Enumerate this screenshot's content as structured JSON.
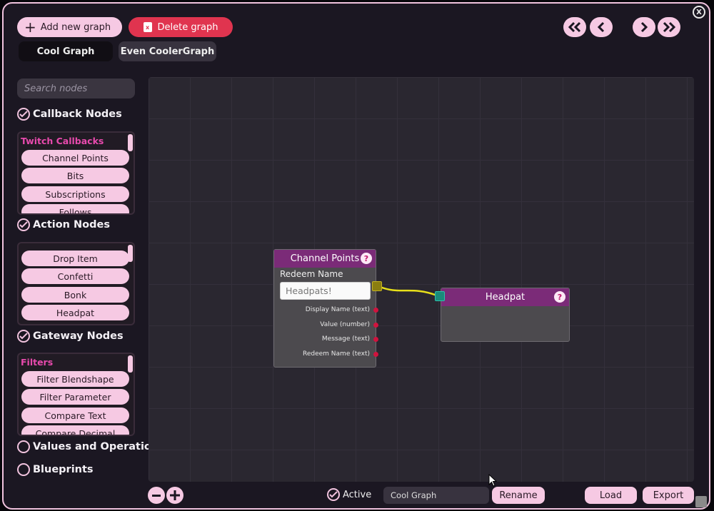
{
  "toolbar": {
    "add_graph_label": "Add new graph",
    "delete_graph_label": "Delete graph",
    "close_label": "X"
  },
  "tabs": [
    {
      "label": "Cool Graph",
      "active": true
    },
    {
      "label": "Even CoolerGraph",
      "active": false
    }
  ],
  "nav": {
    "first_icon": "double-chevron-left-icon",
    "prev_icon": "chevron-left-icon",
    "next_icon": "chevron-right-icon",
    "last_icon": "double-chevron-right-icon"
  },
  "sidebar": {
    "search_placeholder": "Search nodes",
    "sections": [
      {
        "label": "Callback Nodes",
        "checked": true,
        "category": "Twitch Callbacks",
        "items": [
          "Channel Points",
          "Bits",
          "Subscriptions",
          "Follows"
        ]
      },
      {
        "label": "Action Nodes",
        "checked": true,
        "category": "",
        "items": [
          "Drop Item",
          "Confetti",
          "Bonk",
          "Headpat"
        ]
      },
      {
        "label": "Gateway Nodes",
        "checked": true,
        "category": "Filters",
        "items": [
          "Filter Blendshape",
          "Filter Parameter",
          "Compare Text",
          "Compare Decimal"
        ]
      }
    ],
    "extra_sections": [
      {
        "label": "Values and Operations",
        "checked": false
      },
      {
        "label": "Blueprints",
        "checked": false
      }
    ]
  },
  "nodes": {
    "channel_points": {
      "title": "Channel Points",
      "field_label": "Redeem Name",
      "field_value": "Headpats!",
      "outputs": [
        "Display Name (text)",
        "Value (number)",
        "Message (text)",
        "Redeem Name (text)"
      ]
    },
    "headpat": {
      "title": "Headpat"
    },
    "help_label": "?"
  },
  "bottom": {
    "active_label": "Active",
    "active_checked": true,
    "graph_name_value": "Cool Graph",
    "rename_label": "Rename",
    "load_label": "Load",
    "export_label": "Export"
  },
  "colors": {
    "accent_pink": "#f6c9e3",
    "delete_red": "#e0344f",
    "node_header": "#7b2b78",
    "category_text": "#e84aad",
    "connection": "#e8e01a"
  }
}
